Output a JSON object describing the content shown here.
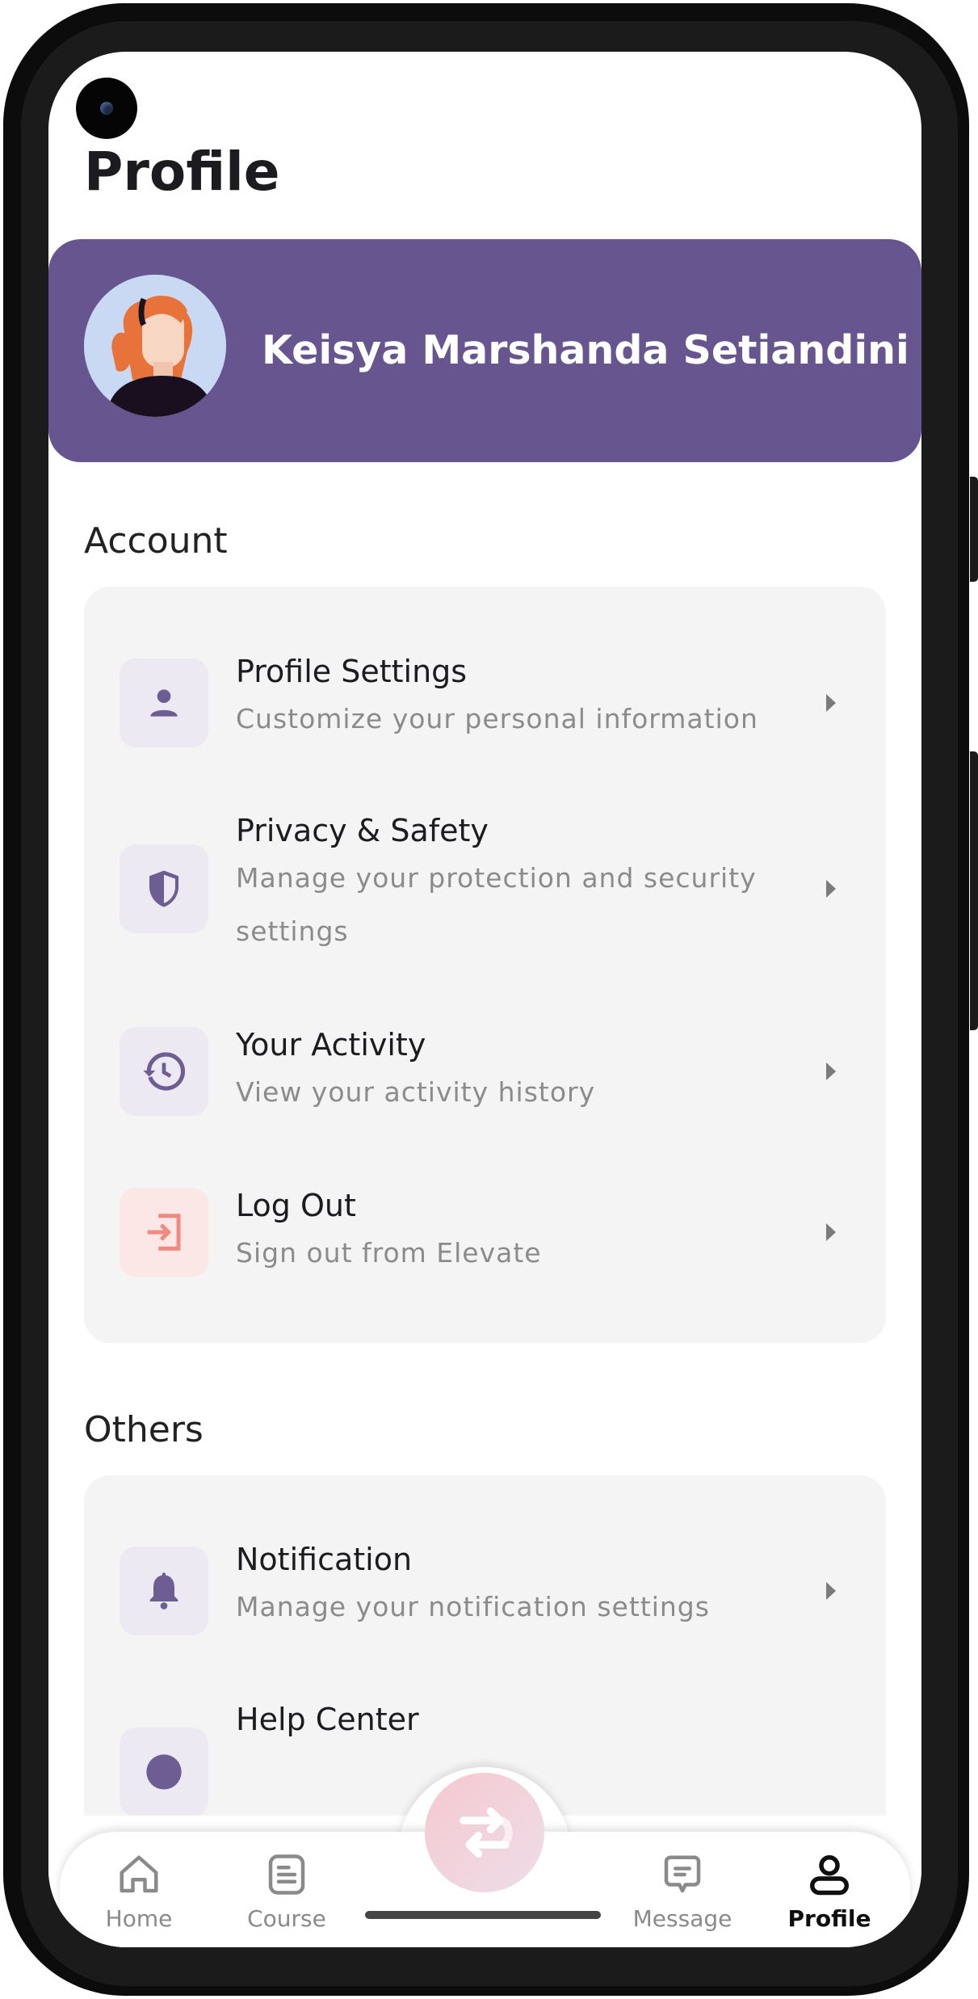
{
  "header": {
    "title": "Profile"
  },
  "user": {
    "name": "Keisya Marshanda Setiandini"
  },
  "sections": [
    {
      "label": "Account",
      "items": [
        {
          "title": "Profile Settings",
          "subtitle": "Customize your personal information",
          "icon": "person-icon"
        },
        {
          "title": "Privacy & Safety",
          "subtitle": "Manage your protection and security settings",
          "icon": "shield-icon"
        },
        {
          "title": "Your Activity",
          "subtitle": "View your activity history",
          "icon": "history-icon"
        },
        {
          "title": "Log Out",
          "subtitle": "Sign out from Elevate",
          "icon": "logout-icon"
        }
      ]
    },
    {
      "label": "Others",
      "items": [
        {
          "title": "Notification",
          "subtitle": "Manage your notification settings",
          "icon": "bell-icon"
        },
        {
          "title": "Help Center",
          "subtitle": "",
          "icon": "help-icon"
        }
      ]
    }
  ],
  "nav": [
    {
      "label": "Home",
      "icon": "home-icon"
    },
    {
      "label": "Course",
      "icon": "course-icon"
    },
    {
      "label": "Message",
      "icon": "message-icon"
    },
    {
      "label": "Profile",
      "icon": "profile-icon",
      "active": true
    }
  ],
  "colors": {
    "brand": "#67558f",
    "icon_tint": "#6e5d93",
    "danger": "#f08a80",
    "card_bg": "#f4f4f4"
  }
}
